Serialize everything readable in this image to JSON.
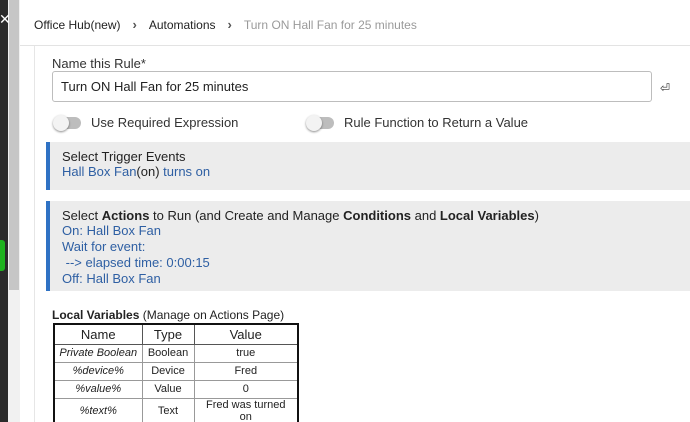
{
  "breadcrumb": {
    "items": [
      "Office Hub(new)",
      "Automations",
      "Turn ON Hall Fan for 25 minutes"
    ]
  },
  "rule": {
    "name_label": "Name this Rule*",
    "name_value": "Turn ON Hall Fan for 25 minutes"
  },
  "options": {
    "required_expression": {
      "label": "Use Required Expression",
      "on": false
    },
    "rule_function": {
      "label": "Rule Function to Return a Value",
      "on": false
    }
  },
  "trigger": {
    "title": "Select Trigger Events",
    "device": "Hall Box Fan",
    "state": "(on)",
    "action": " turns on"
  },
  "actions": {
    "title_parts": [
      "Select ",
      "Actions",
      " to Run (and Create and Manage ",
      "Conditions",
      " and ",
      "Local Variables",
      ")"
    ],
    "lines": [
      "On: Hall Box Fan",
      "Wait for event:",
      " --> elapsed time: 0:00:15",
      "Off: Hall Box Fan"
    ]
  },
  "local_variables": {
    "title": "Local Variables",
    "subtitle": " (Manage on Actions Page)",
    "columns": [
      "Name",
      "Type",
      "Value"
    ],
    "rows": [
      [
        "Private Boolean",
        "Boolean",
        "true"
      ],
      [
        "%device%",
        "Device",
        "Fred"
      ],
      [
        "%value%",
        "Value",
        "0"
      ],
      [
        "%text%",
        "Text",
        "Fred was turned on"
      ]
    ]
  },
  "colors": {
    "accent": "#2f72c4",
    "link_text": "#2e5fa3",
    "section_bg": "#ececec",
    "rail": "#2b2b2b",
    "status_green": "#1fb31f"
  }
}
